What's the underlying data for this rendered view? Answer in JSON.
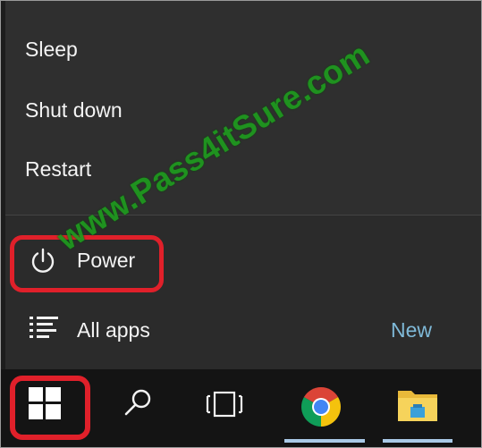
{
  "power_menu": {
    "items": [
      {
        "label": "Sleep"
      },
      {
        "label": "Shut down"
      },
      {
        "label": "Restart"
      }
    ]
  },
  "start_menu": {
    "power_label": "Power",
    "all_apps_label": "All apps",
    "new_label": "New"
  },
  "taskbar": {
    "icons": [
      "windows-logo-icon",
      "search-icon",
      "task-view-icon",
      "chrome-icon",
      "file-explorer-icon"
    ]
  },
  "watermark": "www.Pass4itSure.com",
  "colors": {
    "highlight": "#e0202a",
    "new_accent": "#7fb9d8",
    "watermark": "#1e9b1e",
    "taskbar": "#141414",
    "menu": "#2b2b2b"
  }
}
